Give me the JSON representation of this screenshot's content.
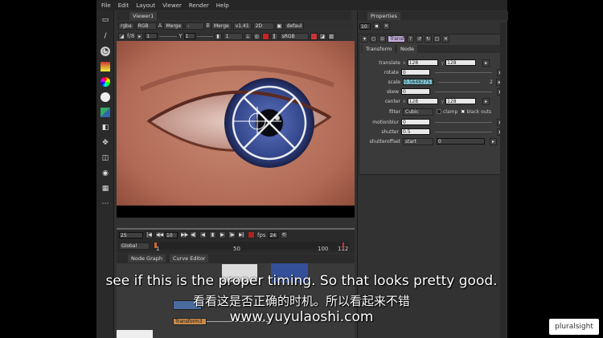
{
  "menu": [
    "File",
    "Edit",
    "Layout",
    "Viewer",
    "Render",
    "Help"
  ],
  "viewer": {
    "tab": "Viewer1",
    "channel": "rgba",
    "rgb": "RGB",
    "a_label": "A",
    "merge_a": "Merge",
    "dash": "-",
    "b_label": "B",
    "merge_b": "Merge",
    "zoom": "v1.41",
    "mode": "2D",
    "lut": "defaul",
    "fstop": "f/8",
    "fval": "1",
    "y": "Y",
    "yval": "1",
    "frame": "1",
    "colorspace": "sRGB"
  },
  "timeline": {
    "frame": "25",
    "step": "10",
    "fps_label": "fps",
    "fps": "24",
    "global": "Global",
    "ticks": [
      "1",
      "50",
      "100",
      "112"
    ]
  },
  "nodegraph": {
    "tabs": [
      "Node Graph",
      "Curve Editor"
    ],
    "nodes": [
      "Transform3"
    ]
  },
  "properties": {
    "title": "Properties",
    "count": "10",
    "node_name": "Transform3",
    "tabs": [
      "Transform",
      "Node"
    ],
    "translate": {
      "label": "translate",
      "x": "128",
      "y": "128"
    },
    "rotate": {
      "label": "rotate",
      "value": "0"
    },
    "scale": {
      "label": "scale",
      "value": "0.56482751",
      "extra": "2"
    },
    "skew": {
      "label": "skew",
      "value": "0"
    },
    "center": {
      "label": "center",
      "x": "128",
      "y": "128"
    },
    "filter": {
      "label": "filter",
      "value": "Cubic",
      "clamp": "clamp",
      "black": "black outs"
    },
    "motionblur": {
      "label": "motionblur",
      "value": "0"
    },
    "shutter": {
      "label": "shutter",
      "value": "0.5"
    },
    "shutteroffset": {
      "label": "shutteroffset",
      "value": "start",
      "extra": "0"
    }
  },
  "subtitles": {
    "en": "see if this is the proper timing. So that looks pretty good.",
    "zh": "看看这是否正确的时机。所以看起来不错",
    "url": "www.yuyulaoshi.com"
  },
  "watermark": "pluralsight"
}
